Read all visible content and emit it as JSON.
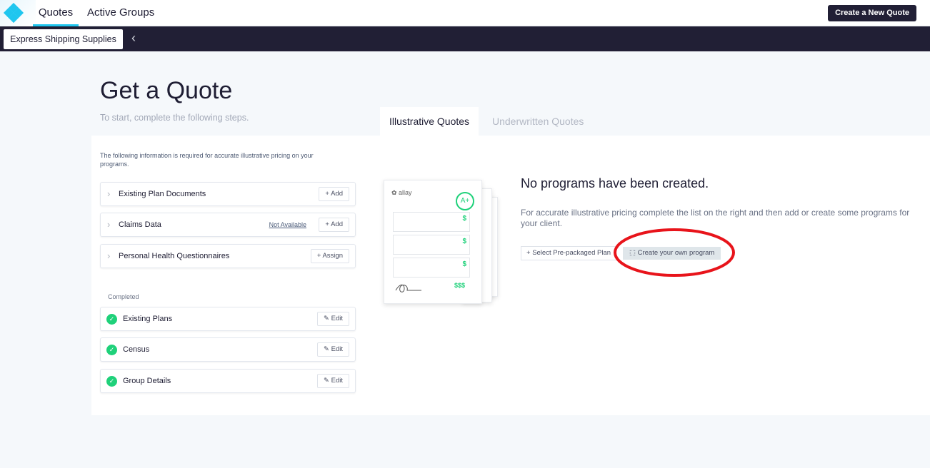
{
  "nav": {
    "tabs": [
      {
        "label": "Quotes",
        "active": true
      },
      {
        "label": "Active Groups",
        "active": false
      }
    ],
    "cta": "Create a New Quote"
  },
  "subnav": {
    "group": "Express Shipping Supplies"
  },
  "page": {
    "title": "Get a Quote",
    "subtitle": "To start, complete the following steps."
  },
  "tabs": [
    {
      "label": "Illustrative Quotes",
      "active": true
    },
    {
      "label": "Underwritten Quotes",
      "active": false
    }
  ],
  "info": "The following information is required for accurate illustrative pricing on your programs.",
  "required": [
    {
      "label": "Existing Plan Documents",
      "action": "+ Add"
    },
    {
      "label": "Claims Data",
      "status": "Not Available",
      "action": "+ Add"
    },
    {
      "label": "Personal Health Questionnaires",
      "action": "+ Assign"
    }
  ],
  "completed_label": "Completed",
  "completed": [
    {
      "label": "Existing Plans",
      "action": "Edit"
    },
    {
      "label": "Census",
      "action": "Edit"
    },
    {
      "label": "Group Details",
      "action": "Edit"
    }
  ],
  "illustration": {
    "brand": "allay",
    "grade": "A+",
    "price": "$",
    "total": "$$$"
  },
  "empty": {
    "title": "No programs have been created.",
    "description": "For accurate illustrative pricing complete the list on the right and then add or create some programs for your client.",
    "select_plan": "Select Pre-packaged Plan",
    "create_program": "Create your own program"
  },
  "colors": {
    "accent": "#1fc6ef",
    "dark": "#211f35",
    "success": "#1fd17a",
    "annotation": "#e8141b"
  }
}
